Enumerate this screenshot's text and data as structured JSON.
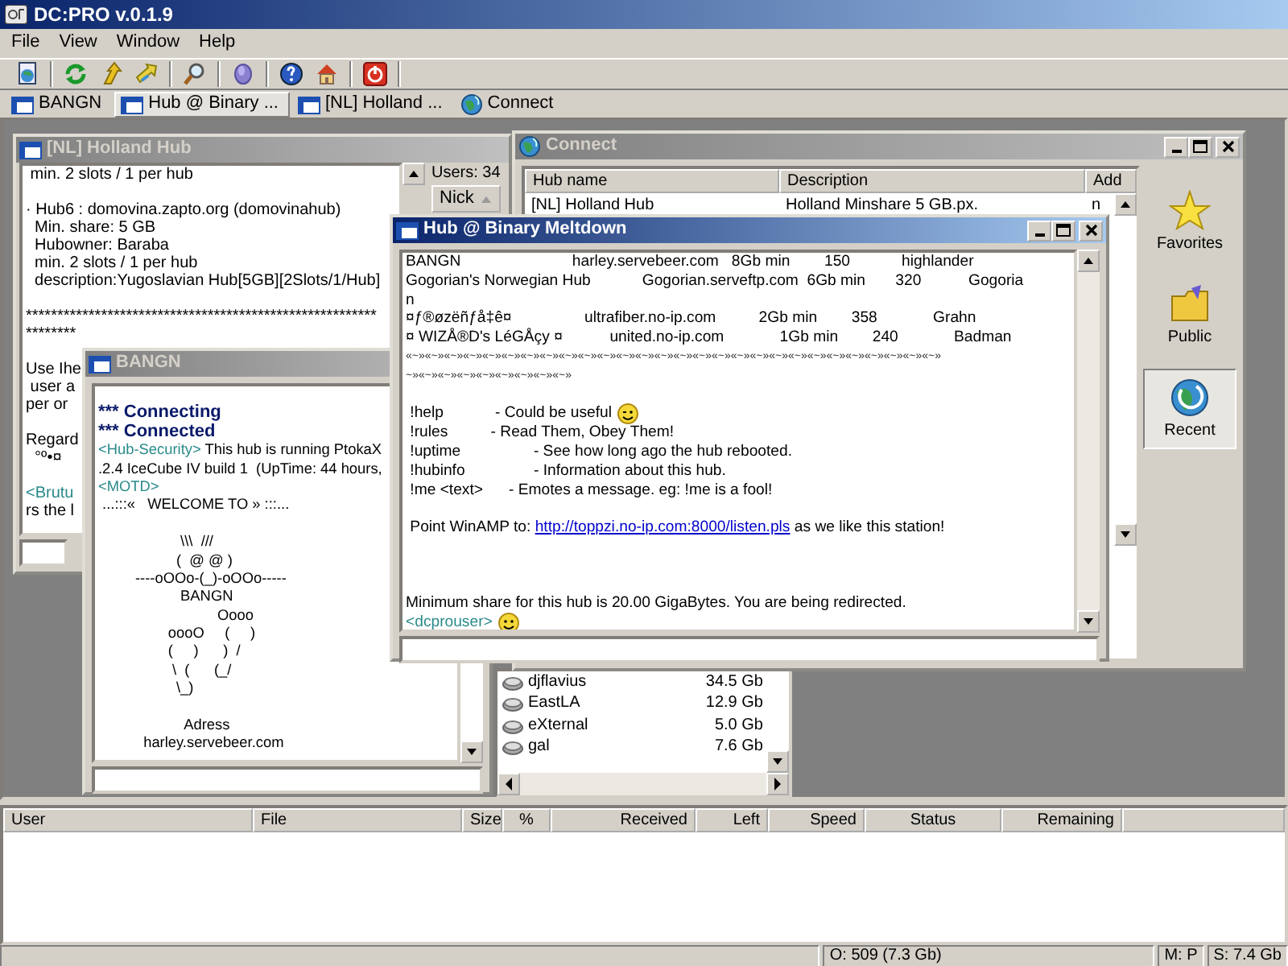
{
  "app": {
    "title": "DC:PRO v.0.1.9"
  },
  "menu": [
    "File",
    "View",
    "Window",
    "Help"
  ],
  "tabs": [
    {
      "label": "BANGN",
      "kind": "hub",
      "selected": false
    },
    {
      "label": "Hub @ Binary ...",
      "kind": "hub",
      "selected": true
    },
    {
      "label": "[NL] Holland ...",
      "kind": "hub",
      "selected": false
    },
    {
      "label": "Connect",
      "kind": "connect",
      "selected": false
    }
  ],
  "holland_window": {
    "title": "[NL] Holland Hub",
    "active": false,
    "lines": [
      {
        "kind": "plain",
        "text": " min. 2 slots / 1 per hub"
      },
      {
        "kind": "blank"
      },
      {
        "kind": "plain",
        "text": "· Hub6 : domovina.zapto.org (domovinahub)"
      },
      {
        "kind": "plain",
        "text": "  Min. share: 5 GB"
      },
      {
        "kind": "plain",
        "text": "  Hubowner: Baraba"
      },
      {
        "kind": "plain",
        "text": "  min. 2 slots / 1 per hub"
      },
      {
        "kind": "plain",
        "text": "  description:Yugoslavian Hub[5GB][2Slots/1/Hub]"
      },
      {
        "kind": "blank"
      },
      {
        "kind": "plain",
        "text": "********************************************************"
      },
      {
        "kind": "plain",
        "text": "********"
      },
      {
        "kind": "blank"
      },
      {
        "kind": "plain",
        "text": "Use Ihe"
      },
      {
        "kind": "plain",
        "text": " user a"
      },
      {
        "kind": "plain",
        "text": "per or"
      },
      {
        "kind": "blank"
      },
      {
        "kind": "plain",
        "text": "Regard"
      },
      {
        "kind": "plain",
        "text": "  °º•¤"
      },
      {
        "kind": "blank"
      },
      {
        "kind": "tagged",
        "tag": "<Brutu"
      },
      {
        "kind": "plain",
        "text": "rs the l"
      }
    ]
  },
  "user_list": {
    "count": "Users: 34",
    "column": "Nick",
    "rows": [
      {
        "nick": "djflavius",
        "share": "34.5 Gb"
      },
      {
        "nick": "EastLA",
        "share": "12.9 Gb"
      },
      {
        "nick": "eXternal",
        "share": "5.0 Gb"
      },
      {
        "nick": "gal",
        "share": "7.6 Gb"
      }
    ]
  },
  "connect_window": {
    "title": "Connect",
    "active": false,
    "columns": [
      "Hub name",
      "Description",
      "Add"
    ],
    "rows": [
      [
        "[NL] Holland Hub",
        "Holland Minshare 5 GB.px.",
        "n"
      ]
    ],
    "shortcuts": [
      {
        "label": "Favorites",
        "kind": "favorites",
        "selected": false
      },
      {
        "label": "Public",
        "kind": "public",
        "selected": false
      },
      {
        "label": "Recent",
        "kind": "recent",
        "selected": true
      }
    ]
  },
  "bangn_window": {
    "title": "BANGN",
    "active": false,
    "lines": [
      {
        "kind": "blank"
      },
      {
        "kind": "status",
        "text": "*** Connecting"
      },
      {
        "kind": "status",
        "text": "*** Connected"
      },
      {
        "kind": "tagged",
        "tag": "<Hub-Security>",
        "text": " This hub is running PtokaX"
      },
      {
        "kind": "plain",
        "text": ".2.4 IceCube IV build 1  (UpTime: 44 hours,"
      },
      {
        "kind": "tagged",
        "tag": "<MOTD>"
      },
      {
        "kind": "plain",
        "text": " ...:::«   WELCOME TO » :::..."
      },
      {
        "kind": "blank"
      },
      {
        "kind": "plain",
        "text": "                    \\\\\\  ///"
      },
      {
        "kind": "plain",
        "text": "                   (  @ @ )"
      },
      {
        "kind": "plain",
        "text": "         ----oOOo-(_)-oOOo-----"
      },
      {
        "kind": "plain",
        "text": "                    BANGN"
      },
      {
        "kind": "plain",
        "text": "                             Oooo"
      },
      {
        "kind": "plain",
        "text": "                 oooO     (     )"
      },
      {
        "kind": "plain",
        "text": "                 (     )      )  /"
      },
      {
        "kind": "plain",
        "text": "                  \\  (      (_/"
      },
      {
        "kind": "plain",
        "text": "                   \\_)"
      },
      {
        "kind": "blank"
      },
      {
        "kind": "plain",
        "text": "                     Adress"
      },
      {
        "kind": "plain",
        "text": "           harley.servebeer.com"
      }
    ]
  },
  "hub_window": {
    "title": "Hub @ Binary Meltdown",
    "active": true,
    "lines": [
      {
        "kind": "plain",
        "text": "BANGN                          harley.servebeer.com   8Gb min        150            highlander"
      },
      {
        "kind": "plain",
        "text": "Gogorian's Norwegian Hub            Gogorian.serveftp.com  6Gb min       320           Gogoria"
      },
      {
        "kind": "plain",
        "text": "n"
      },
      {
        "kind": "plain",
        "text": "¤ƒ®øzëñƒå‡ê¤                 ultrafiber.no-ip.com          2Gb min        358             Grahn"
      },
      {
        "kind": "plain",
        "text": "¤ WIZÅ®D's LéGÅçy ¤           united.no-ip.com             1Gb min        240             Badman"
      },
      {
        "kind": "ornament",
        "text": "«~»«~»«~»«~»«~»«~»«~»«~»«~»«~»«~»«~»«~»«~»«~»«~»«~»«~»«~»«~»«~»«~»«~»«~»«~»«~»«~»«~»"
      },
      {
        "kind": "ornament",
        "text": "~»«~»«~»«~»«~»«~»«~»«~»«~»"
      },
      {
        "kind": "blank"
      },
      {
        "kind": "plain",
        "text": " !help            - Could be useful",
        "emoticon": {
          "kind": "wink"
        }
      },
      {
        "kind": "plain",
        "text": " !rules          - Read Them, Obey Them!"
      },
      {
        "kind": "plain",
        "text": " !uptime                 - See how long ago the hub rebooted."
      },
      {
        "kind": "plain",
        "text": " !hubinfo                - Information about this hub."
      },
      {
        "kind": "plain",
        "text": " !me <text>      - Emotes a message. eg: !me is a fool!"
      },
      {
        "kind": "blank"
      },
      {
        "kind": "link",
        "text": " Point WinAMP to: ",
        "link": "http://toppzi.no-ip.com:8000/listen.pls",
        "after": " as we like this station!"
      },
      {
        "kind": "blank"
      },
      {
        "kind": "blank"
      },
      {
        "kind": "blank"
      },
      {
        "kind": "plain",
        "text": "Minimum share for this hub is 20.00 GigaBytes. You are being redirected."
      },
      {
        "kind": "tagged",
        "tag": "<dcprouser>",
        "emoticon": {
          "kind": "smile"
        }
      }
    ]
  },
  "transfers": {
    "columns": [
      "User",
      "File",
      "Size",
      "%",
      "Received",
      "Left",
      "Speed",
      "Status",
      "Remaining"
    ]
  },
  "status_bar": [
    "O: 509 (7.3 Gb)",
    "M: P",
    "S: 7.4 Gb"
  ]
}
